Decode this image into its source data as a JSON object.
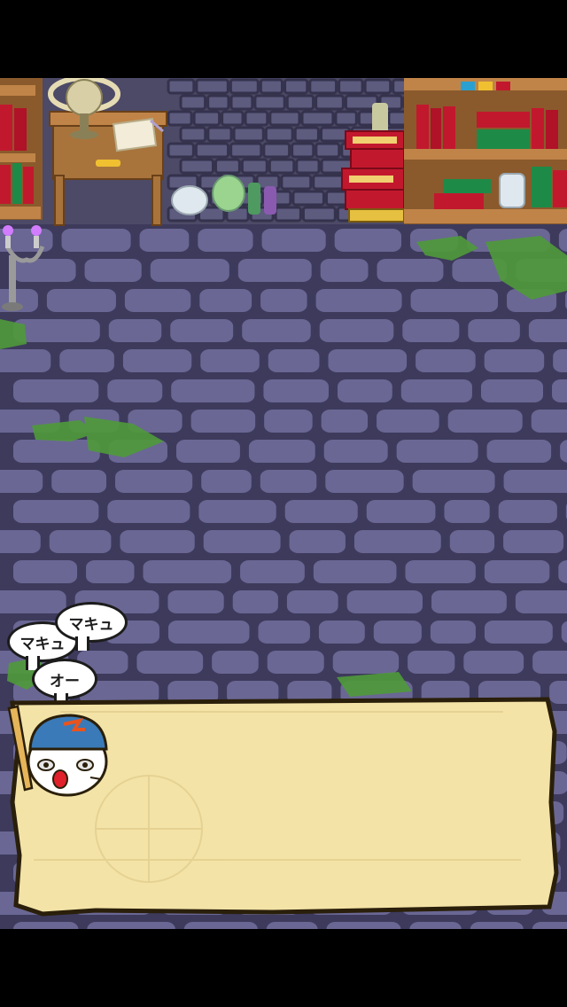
{
  "dialogue": {
    "bubbles": [
      "マキュ",
      "マキュ",
      "オー"
    ],
    "message": ""
  },
  "colors": {
    "floor": "#56537e",
    "stone": "#6a6794",
    "mortar": "#3d3a5c",
    "wall": "#4c4a66",
    "wood": "#a8743c",
    "parchment": "#f3e3a7",
    "moss": "#4f9a3a",
    "candle_flame": "#d27cff"
  },
  "icons": [
    "bat-icon",
    "helmet-icon",
    "candelabra-icon",
    "globe-icon",
    "scroll-icon",
    "bottle-icon",
    "book-icon"
  ]
}
